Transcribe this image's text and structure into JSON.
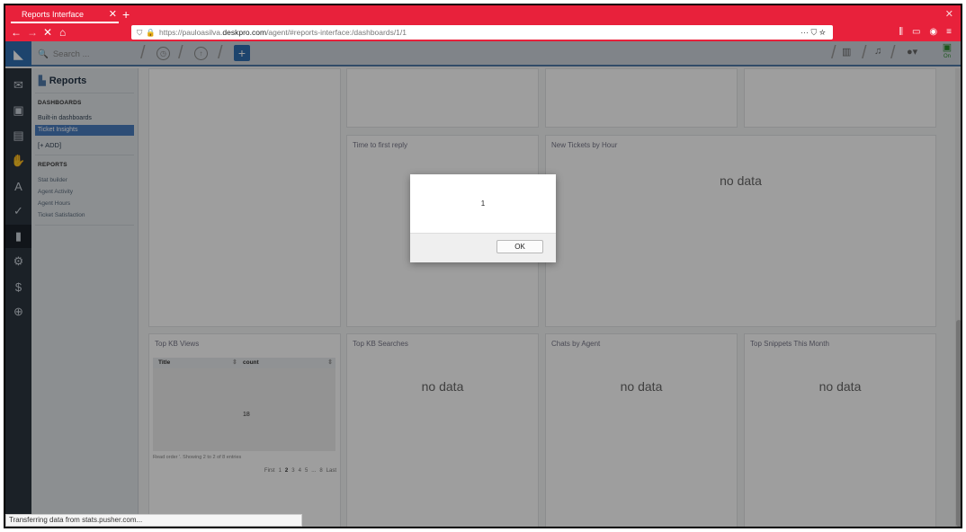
{
  "browser": {
    "tab_title": "Reports Interface",
    "url_prefix": "https://pauloasilva.",
    "url_domain": "deskpro.com",
    "url_path": "/agent/#reports-interface:/dashboards/1/1"
  },
  "app": {
    "search_placeholder": "Search ...",
    "nav": {
      "title": "Reports",
      "dashboards_heading": "DASHBOARDS",
      "dashboards": [
        "Built-in dashboards",
        "Ticket Insights"
      ],
      "add_label": "[+ ADD]",
      "reports_heading": "REPORTS",
      "reports": [
        "Stat builder",
        "Agent Activity",
        "Agent Hours",
        "Ticket Satisfaction"
      ]
    },
    "panels": {
      "time_first_reply": "Time to first reply",
      "new_tickets_hour": "New Tickets by Hour",
      "top_kb_views": "Top KB Views",
      "top_kb_searches": "Top KB Searches",
      "chats_by_agent": "Chats by Agent",
      "top_snippets": "Top Snippets This Month",
      "no_data": "no data"
    },
    "kb_table": {
      "col_title": "Title",
      "col_count": "count",
      "value": "18",
      "info": "Read order '. Showing 2 to 2 of 8 entries",
      "pager": [
        "First",
        "1",
        "2",
        "3",
        "4",
        "5",
        "...",
        "8",
        "Last"
      ]
    }
  },
  "dialog": {
    "message": "1",
    "ok_label": "OK"
  },
  "status_text": "Transferring data from stats.pusher.com..."
}
